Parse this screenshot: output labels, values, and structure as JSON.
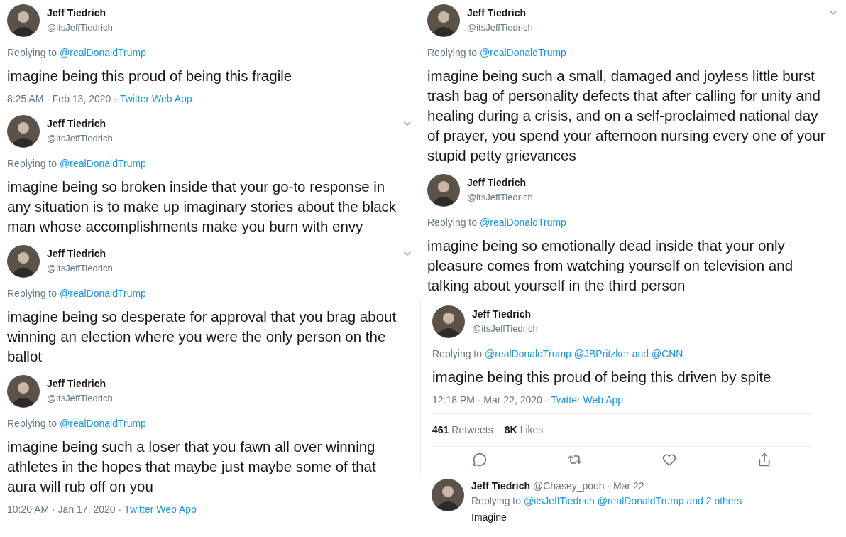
{
  "columns": [
    {
      "tweets": [
        {
          "kind": "tweet",
          "name": "Jeff Tiedrich",
          "handle": "@itsJeffTiedrich",
          "menu": false,
          "replying_label": "Replying to",
          "replying_to": "@realDonaldTrump",
          "text": "imagine being this proud of being this fragile",
          "time": "8:25 AM · Feb 13, 2020 ·",
          "source": "Twitter Web App"
        },
        {
          "kind": "tweet",
          "name": "Jeff Tiedrich",
          "handle": "@itsJeffTiedrich",
          "menu": true,
          "replying_label": "Replying to",
          "replying_to": "@realDonaldTrump",
          "text": "imagine being so broken inside that your go-to response in any situation is to make up imaginary stories about the black man whose accomplishments make you burn with envy"
        },
        {
          "kind": "tweet",
          "name": "Jeff Tiedrich",
          "handle": "@itsJeffTiedrich",
          "menu": true,
          "replying_label": "Replying to",
          "replying_to": "@realDonaldTrump",
          "text": "imagine being so desperate for approval that you brag about winning an election where you were the only person on the ballot"
        },
        {
          "kind": "tweet",
          "name": "Jeff Tiedrich",
          "handle": "@itsJeffTiedrich",
          "menu": false,
          "replying_label": "Replying to",
          "replying_to": "@realDonaldTrump",
          "text": "imagine being such a loser that you fawn all over winning athletes in the hopes that maybe just maybe some of that aura will rub off on you",
          "time": "10:20 AM · Jan 17, 2020 ·",
          "source": "Twitter Web App"
        }
      ]
    },
    {
      "tweets": [
        {
          "kind": "tweet",
          "name": "Jeff Tiedrich",
          "handle": "@itsJeffTiedrich",
          "menu": true,
          "replying_label": "Replying to",
          "replying_to": "@realDonaldTrump",
          "text": "imagine being such a small, damaged and joyless little burst trash bag of personality defects that after calling for unity and healing during a crisis, and on a self-proclaimed national day of prayer, you spend your afternoon nursing every one of your stupid petty grievances"
        },
        {
          "kind": "tweet",
          "name": "Jeff Tiedrich",
          "handle": "@itsJeffTiedrich",
          "menu": false,
          "replying_label": "Replying to",
          "replying_to": "@realDonaldTrump",
          "text": "imagine being so emotionally dead inside that your only pleasure comes from watching yourself on television and talking about yourself in the third person"
        },
        {
          "kind": "detail",
          "name": "Jeff Tiedrich",
          "handle": "@itsJeffTiedrich",
          "menu": false,
          "replying_label": "Replying to",
          "replying_to": "@realDonaldTrump @JBPritzker and @CNN",
          "text": "imagine being this proud of being this driven by spite",
          "time": "12:18 PM · Mar 22, 2020 ·",
          "source": "Twitter Web App",
          "stats": [
            {
              "count": "461",
              "label": "Retweets"
            },
            {
              "count": "8K",
              "label": "Likes"
            }
          ]
        },
        {
          "kind": "reply",
          "name": "Jeff Tiedrich",
          "handle": "@Chasey_pooh · Mar 22",
          "replying_label": "Replying to",
          "replying_to": "@itsJeffTiedrich @realDonaldTrump and 2 others",
          "text": "Imagine"
        }
      ]
    }
  ]
}
